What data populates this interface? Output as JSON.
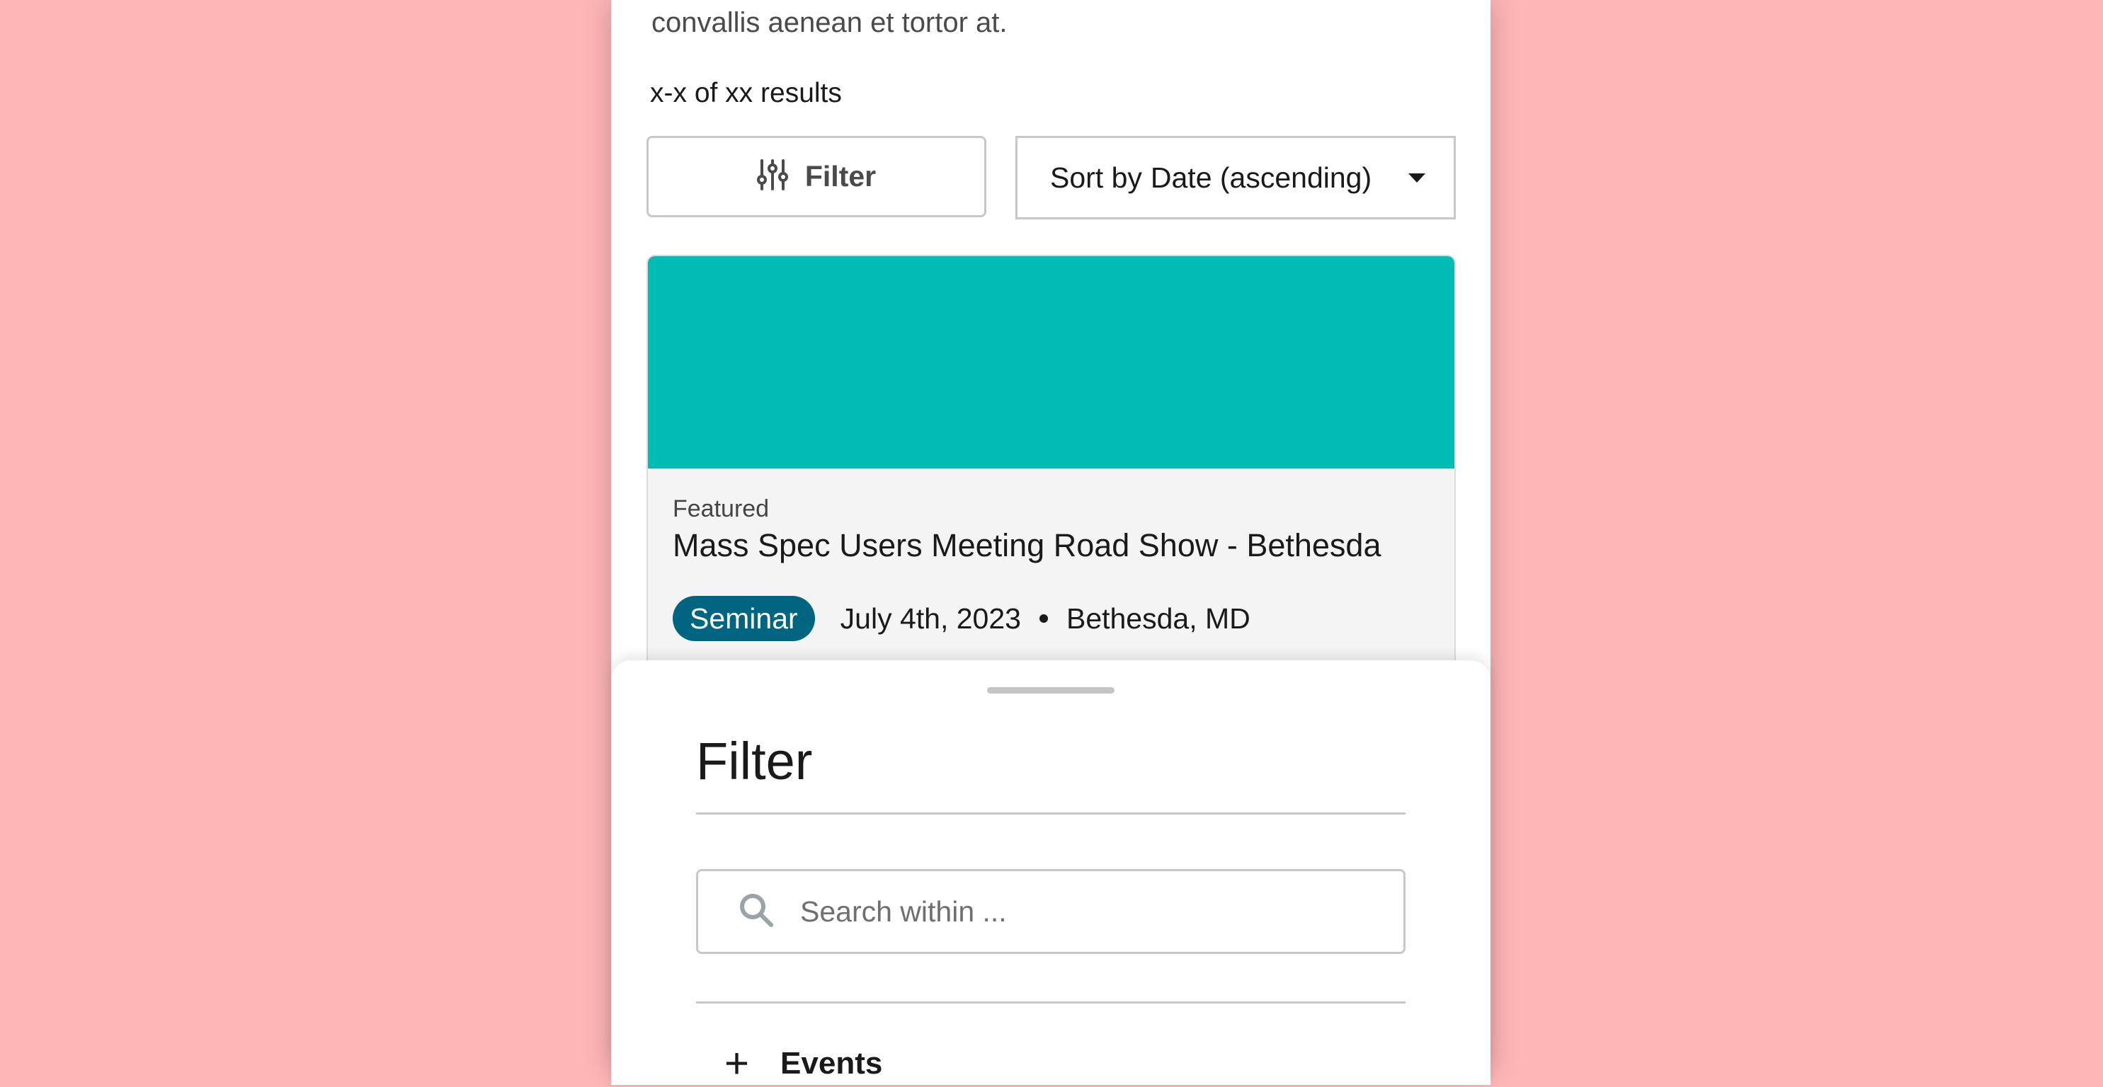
{
  "page": {
    "intro_text": "convallis aenean et tortor at.",
    "results_count": "x-x of xx results"
  },
  "toolbar": {
    "filter_label": "Filter",
    "filter_icon": "sliders-icon",
    "sort_prefix": "Sort by",
    "sort_value": "Date (ascending)",
    "sort_icon": "caret-down-icon"
  },
  "event_card": {
    "eyebrow": "Featured",
    "title": "Mass Spec Users Meeting Road Show - Bethesda",
    "badge": "Seminar",
    "date": "July 4th, 2023",
    "location": "Bethesda, MD",
    "banner_color": "#00bcb3",
    "badge_color": "#006580"
  },
  "filter_sheet": {
    "title": "Filter",
    "search_placeholder": "Search within ...",
    "search_icon": "search-icon",
    "accordion_items": [
      {
        "label": "Events",
        "icon": "plus-icon"
      }
    ]
  },
  "colors": {
    "background": "#ffb6b7",
    "accent_teal": "#00bcb3",
    "badge_navy": "#006580"
  }
}
